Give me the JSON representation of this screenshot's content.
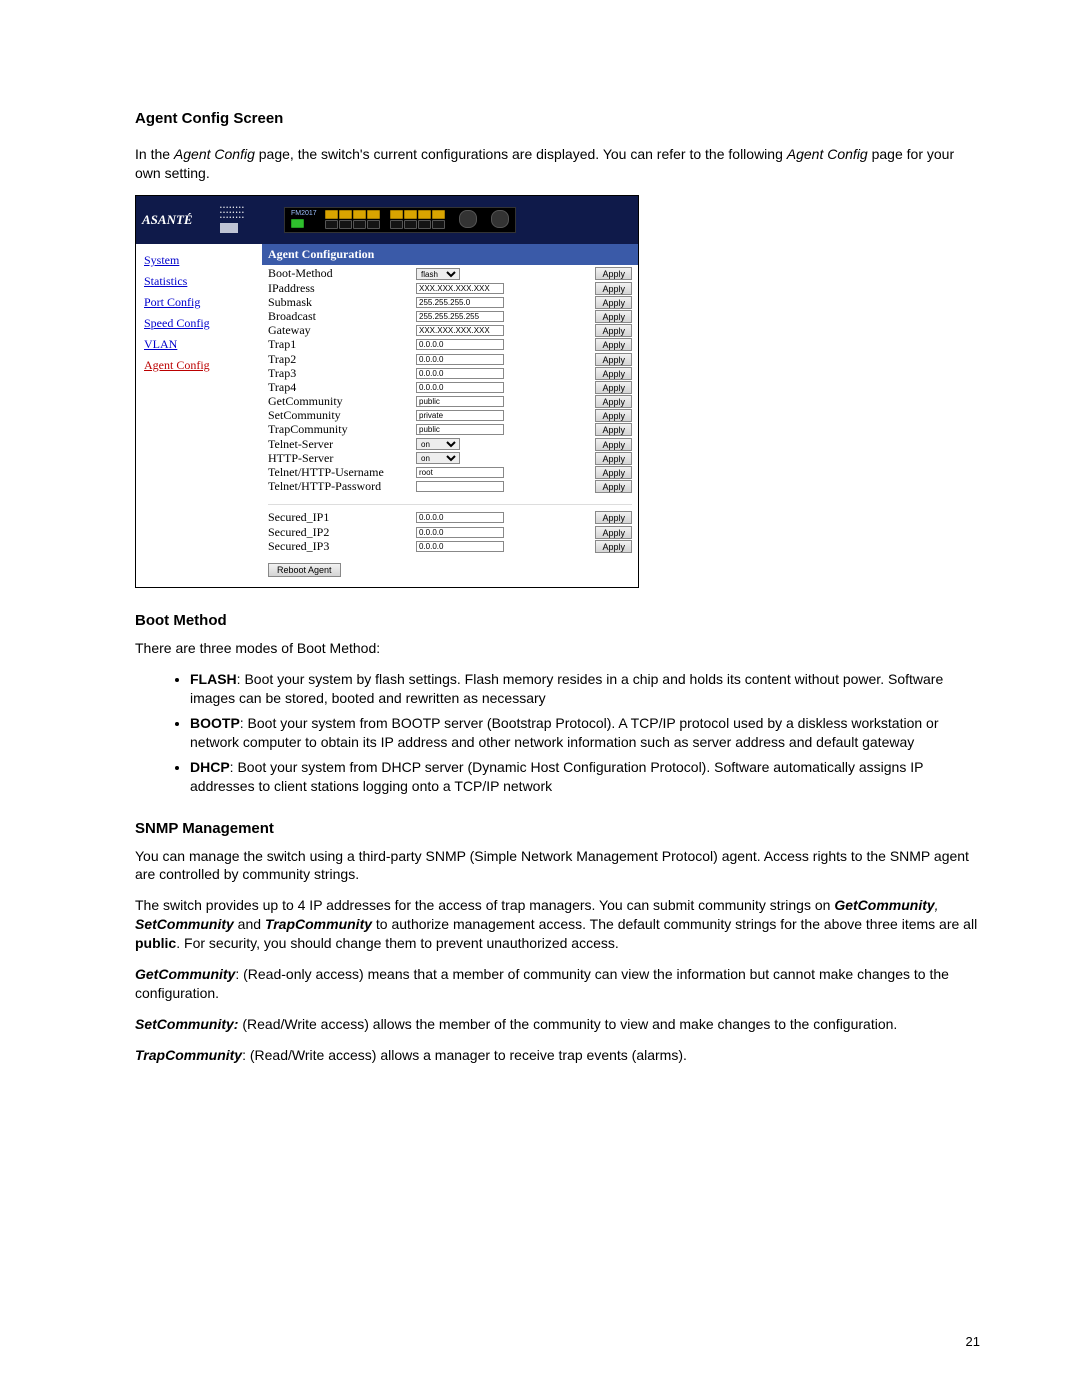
{
  "page_number": "21",
  "title": "Agent Config Screen",
  "intro_pre": "In the ",
  "intro_em1": "Agent Config",
  "intro_mid": " page, the switch's current configurations are displayed. You can refer to the following ",
  "intro_em2": "Agent Config",
  "intro_post": " page for your own setting.",
  "device": {
    "brand": "ASANTÉ",
    "model": "FM2017"
  },
  "sidenav": {
    "items": [
      {
        "label": "System",
        "active": false
      },
      {
        "label": "Statistics",
        "active": false
      },
      {
        "label": "Port Config",
        "active": false
      },
      {
        "label": "Speed Config",
        "active": false
      },
      {
        "label": "VLAN",
        "active": false
      },
      {
        "label": "Agent Config",
        "active": true
      }
    ]
  },
  "panel_title": "Agent Configuration",
  "apply_label": "Apply",
  "reboot_label": "Reboot Agent",
  "rows": [
    {
      "label": "Boot-Method",
      "kind": "select",
      "value": "flash"
    },
    {
      "label": "IPaddress",
      "kind": "input",
      "value": "XXX.XXX.XXX.XXX"
    },
    {
      "label": "Submask",
      "kind": "input",
      "value": "255.255.255.0"
    },
    {
      "label": "Broadcast",
      "kind": "input",
      "value": "255.255.255.255"
    },
    {
      "label": "Gateway",
      "kind": "input",
      "value": "XXX.XXX.XXX.XXX"
    },
    {
      "label": "Trap1",
      "kind": "input",
      "value": "0.0.0.0"
    },
    {
      "label": "Trap2",
      "kind": "input",
      "value": "0.0.0.0"
    },
    {
      "label": "Trap3",
      "kind": "input",
      "value": "0.0.0.0"
    },
    {
      "label": "Trap4",
      "kind": "input",
      "value": "0.0.0.0"
    },
    {
      "label": "GetCommunity",
      "kind": "input",
      "value": "public"
    },
    {
      "label": "SetCommunity",
      "kind": "input",
      "value": "private"
    },
    {
      "label": "TrapCommunity",
      "kind": "input",
      "value": "public"
    },
    {
      "label": "Telnet-Server",
      "kind": "select",
      "value": "on"
    },
    {
      "label": "HTTP-Server",
      "kind": "select",
      "value": "on"
    },
    {
      "label": "Telnet/HTTP-Username",
      "kind": "input",
      "value": "root"
    },
    {
      "label": "Telnet/HTTP-Password",
      "kind": "input",
      "value": ""
    }
  ],
  "sec_rows": [
    {
      "label": "Secured_IP1",
      "value": "0.0.0.0"
    },
    {
      "label": "Secured_IP2",
      "value": "0.0.0.0"
    },
    {
      "label": "Secured_IP3",
      "value": "0.0.0.0"
    }
  ],
  "boot": {
    "heading": "Boot Method",
    "intro": "There are three modes of Boot Method:",
    "items": [
      {
        "t": "FLASH",
        "d": ": Boot your system by flash settings. Flash memory resides in a chip and holds its content without power. Software images can be stored, booted and rewritten as necessary"
      },
      {
        "t": "BOOTP",
        "d": ": Boot your system from BOOTP server (Bootstrap Protocol). A TCP/IP protocol used by a diskless workstation or network computer to obtain its IP address and other network information such as server address and default gateway"
      },
      {
        "t": "DHCP",
        "d": ": Boot your system from DHCP server (Dynamic Host Configuration Protocol). Software automatically assigns IP addresses to client stations logging onto a TCP/IP network"
      }
    ]
  },
  "snmp": {
    "heading": "SNMP Management",
    "p1": "You can manage the switch using a third-party SNMP (Simple Network Management Protocol) agent. Access rights to the SNMP agent are controlled by community strings.",
    "p2_pre": "The switch provides up to 4 IP addresses for the access of trap managers. You can submit community strings on ",
    "p2_gc": "GetCommunity",
    "p2_sep1": ", ",
    "p2_sc": "SetCommunity",
    "p2_sep2": " and ",
    "p2_tc": "TrapCommunity",
    "p2_mid": " to authorize management access. The default community strings for the above three items are all ",
    "p2_pub": "public",
    "p2_post": ". For security, you should change them to prevent unauthorized access.",
    "def_gc_t": "GetCommunity",
    "def_gc_d": ": (Read-only access) means that a member of community can view the information but cannot make changes to the configuration.",
    "def_sc_t": "SetCommunity:",
    "def_sc_d": " (Read/Write access) allows the member of the community to view and make changes to the configuration.",
    "def_tc_t": "TrapCommunity",
    "def_tc_d": ": (Read/Write access) allows a manager to receive trap events (alarms)."
  }
}
